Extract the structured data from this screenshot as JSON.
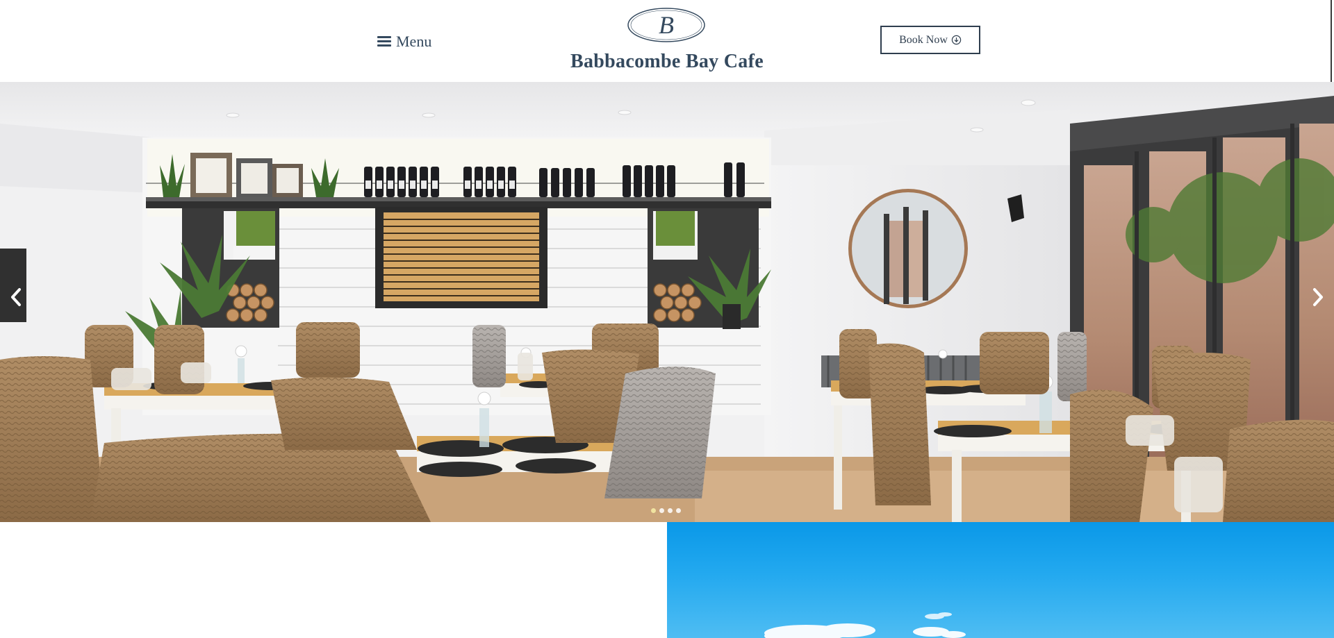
{
  "header": {
    "menu_label": "Menu",
    "logo_letter": "B",
    "site_title": "Babbacombe Bay Cafe",
    "book_button_label": "Book Now",
    "menu_icon": "hamburger-icon",
    "book_icon": "download-circle-icon"
  },
  "hero": {
    "prev_arrow": "‹",
    "next_arrow": "›",
    "slide_count": 4,
    "active_slide": 1,
    "image_subject": "cafe dining room interior"
  },
  "colors": {
    "brand_text": "#34495e",
    "button_border": "#2f3e4e",
    "sky": "#0a98e8"
  }
}
